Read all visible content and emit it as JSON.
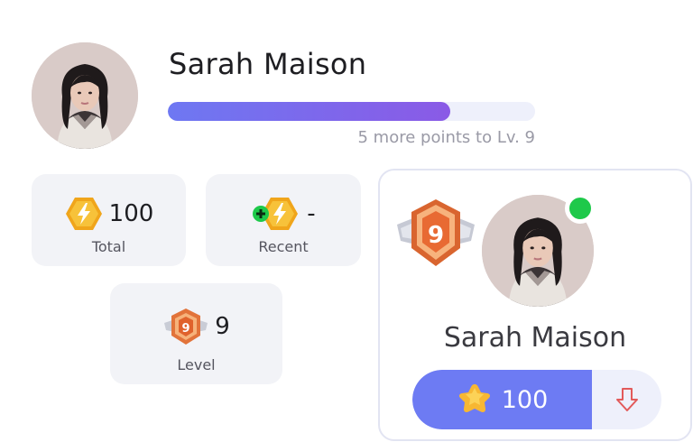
{
  "user": {
    "name": "Sarah Maison",
    "progress_fraction": 0.77,
    "progress_caption": "5 more points to Lv. 9"
  },
  "stats": {
    "total": {
      "value": "100",
      "label": "Total",
      "icon": "lightning-coin-icon"
    },
    "recent": {
      "value": "-",
      "label": "Recent",
      "icon": "plus-lightning-coin-icon"
    },
    "level": {
      "value": "9",
      "label": "Level",
      "icon": "level-shield-badge-icon"
    }
  },
  "profile_card": {
    "name": "Sarah Maison",
    "badge_level": "9",
    "points": "100",
    "points_icon": "star-icon",
    "action_icon": "download-arrow-icon",
    "online": true
  },
  "colors": {
    "accent": "#6d7bf3",
    "progress_start": "#6e78f2",
    "progress_end": "#8a5ae6",
    "online": "#1ec94a",
    "coin": "#f5a623",
    "badge": "#e9763c",
    "download_arrow": "#e25a5a"
  }
}
